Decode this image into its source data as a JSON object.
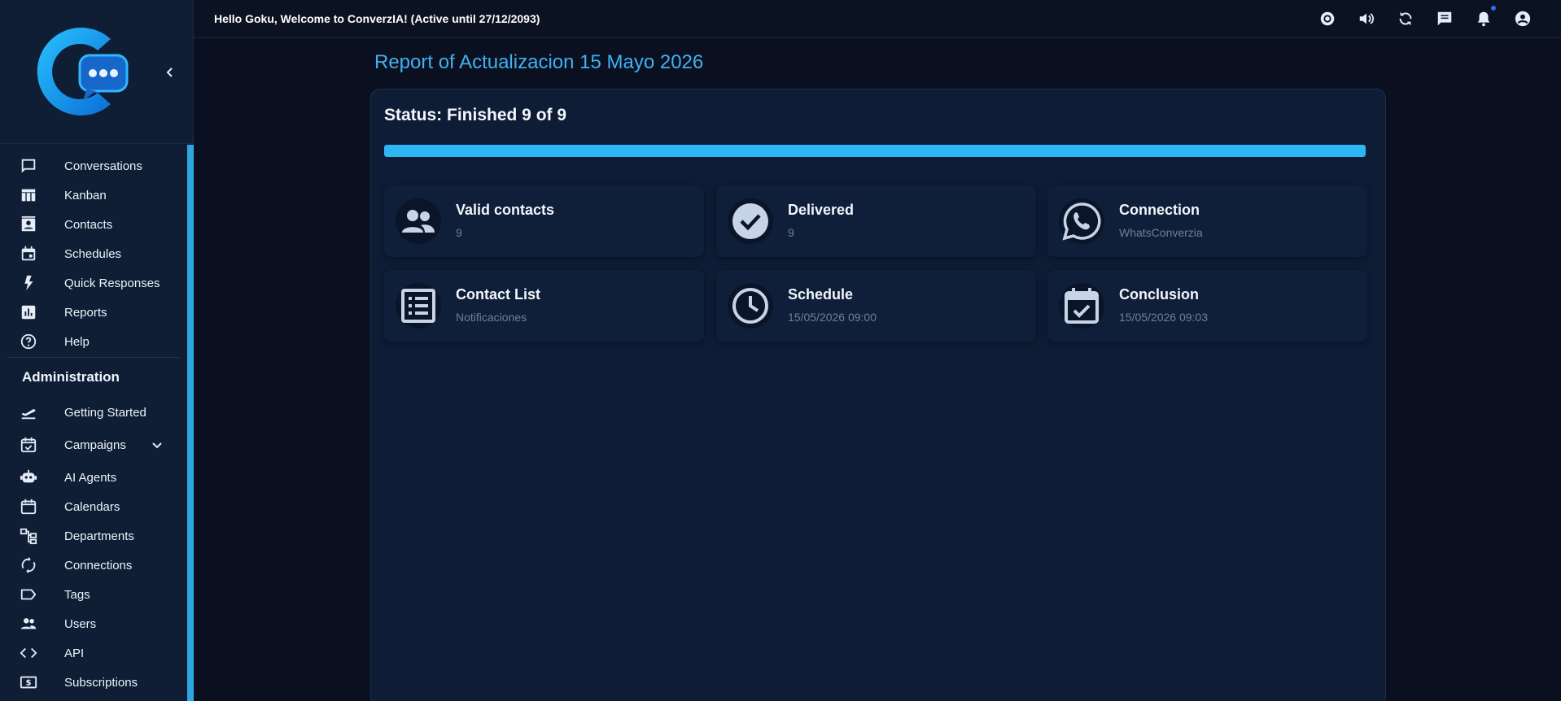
{
  "app": {
    "greeting": "Hello Goku, Welcome to ConverzIA! (Active until 27/12/2093)"
  },
  "colors": {
    "accent": "#3fb2f2",
    "progress": "#2eb6f4",
    "sidebar_bg": "#0f1d35",
    "main_bg": "#0a1020"
  },
  "sidebar": {
    "items": [
      {
        "label": "Conversations",
        "icon": "chat-icon"
      },
      {
        "label": "Kanban",
        "icon": "kanban-icon"
      },
      {
        "label": "Contacts",
        "icon": "contacts-icon"
      },
      {
        "label": "Schedules",
        "icon": "calendar-event-icon"
      },
      {
        "label": "Quick Responses",
        "icon": "bolt-icon"
      },
      {
        "label": "Reports",
        "icon": "chart-icon"
      },
      {
        "label": "Help",
        "icon": "help-icon"
      }
    ],
    "admin_title": "Administration",
    "admin_items": [
      {
        "label": "Getting Started",
        "icon": "flight-takeoff-icon"
      },
      {
        "label": "Campaigns",
        "icon": "event-check-icon"
      },
      {
        "label": "AI Agents",
        "icon": "robot-icon"
      },
      {
        "label": "Calendars",
        "icon": "calendar-icon"
      },
      {
        "label": "Departments",
        "icon": "org-tree-icon"
      },
      {
        "label": "Connections",
        "icon": "sync-icon"
      },
      {
        "label": "Tags",
        "icon": "tag-icon"
      },
      {
        "label": "Users",
        "icon": "users-icon"
      },
      {
        "label": "API",
        "icon": "code-icon"
      },
      {
        "label": "Subscriptions",
        "icon": "dollar-icon"
      }
    ]
  },
  "topbar": {
    "icons": [
      "brightness-icon",
      "volume-icon",
      "refresh-icon",
      "messages-icon",
      "bell-icon",
      "account-icon"
    ]
  },
  "report": {
    "title": "Report of Actualizacion 15 Mayo 2026",
    "status": "Status: Finished 9 of 9",
    "progress_fraction": 1.0,
    "cards": [
      {
        "title": "Valid contacts",
        "value": "9",
        "icon": "group-icon"
      },
      {
        "title": "Delivered",
        "value": "9",
        "icon": "check-circle-icon"
      },
      {
        "title": "Connection",
        "value": "WhatsConverzia",
        "icon": "whatsapp-icon"
      },
      {
        "title": "Contact List",
        "value": "Notificaciones",
        "icon": "list-icon"
      },
      {
        "title": "Schedule",
        "value": "15/05/2026 09:00",
        "icon": "clock-icon"
      },
      {
        "title": "Conclusion",
        "value": "15/05/2026 09:03",
        "icon": "event-available-icon"
      }
    ]
  }
}
